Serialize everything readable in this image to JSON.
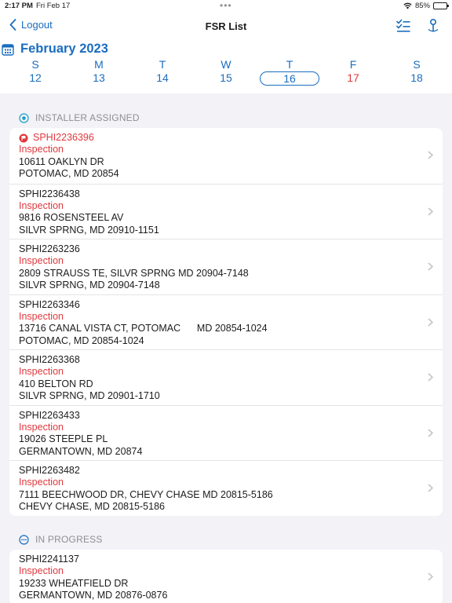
{
  "status_bar": {
    "time": "2:17 PM",
    "date": "Fri Feb 17",
    "battery": "85%",
    "battery_level": 0.85
  },
  "nav": {
    "back_label": "Logout",
    "title": "FSR List"
  },
  "calendar": {
    "month": "February 2023",
    "days": [
      {
        "dow": "S",
        "num": "12"
      },
      {
        "dow": "M",
        "num": "13"
      },
      {
        "dow": "T",
        "num": "14"
      },
      {
        "dow": "W",
        "num": "15"
      },
      {
        "dow": "T",
        "num": "16"
      },
      {
        "dow": "F",
        "num": "17"
      },
      {
        "dow": "S",
        "num": "18"
      }
    ]
  },
  "sections": [
    {
      "title": "INSTALLER ASSIGNED",
      "rows": [
        {
          "id": "SPHI2236396",
          "type": "Inspection",
          "addr1": "10611 OAKLYN DR",
          "addr2": "POTOMAC, MD 20854"
        },
        {
          "id": "SPHI2236438",
          "type": "Inspection",
          "addr1": "9816 ROSENSTEEL AV",
          "addr2": "SILVR SPRNG, MD 20910-1151"
        },
        {
          "id": "SPHI2263236",
          "type": "Inspection",
          "addr1": "2809 STRAUSS TE, SILVR SPRNG MD 20904-7148",
          "addr2": "SILVR SPRNG, MD 20904-7148"
        },
        {
          "id": "SPHI2263346",
          "type": "Inspection",
          "addr1": "13716 CANAL VISTA CT, POTOMAC      MD 20854-1024",
          "addr2": "POTOMAC, MD 20854-1024"
        },
        {
          "id": "SPHI2263368",
          "type": "Inspection",
          "addr1": "410 BELTON RD",
          "addr2": "SILVR SPRNG, MD 20901-1710"
        },
        {
          "id": "SPHI2263433",
          "type": "Inspection",
          "addr1": "19026 STEEPLE PL",
          "addr2": "GERMANTOWN, MD 20874"
        },
        {
          "id": "SPHI2263482",
          "type": "Inspection",
          "addr1": "7111 BEECHWOOD DR, CHEVY CHASE MD 20815-5186",
          "addr2": "CHEVY CHASE, MD 20815-5186"
        }
      ]
    },
    {
      "title": "IN PROGRESS",
      "rows": [
        {
          "id": "SPHI2241137",
          "type": "Inspection",
          "addr1": "19233 WHEATFIELD DR",
          "addr2": "GERMANTOWN, MD 20876-0876"
        }
      ]
    }
  ],
  "colors": {
    "accent": "#1a6dbf",
    "alert": "#e0393e",
    "muted": "#8e8e93"
  },
  "icons": {
    "back": "chevron-left-icon",
    "checklist": "checklist-icon",
    "map_pin": "map-pin-icon",
    "calendar": "calendar-icon",
    "section1": "target-icon",
    "section2": "ellipsis-circle-icon",
    "alert": "flag-icon",
    "row_chevron": "chevron-right-icon"
  }
}
